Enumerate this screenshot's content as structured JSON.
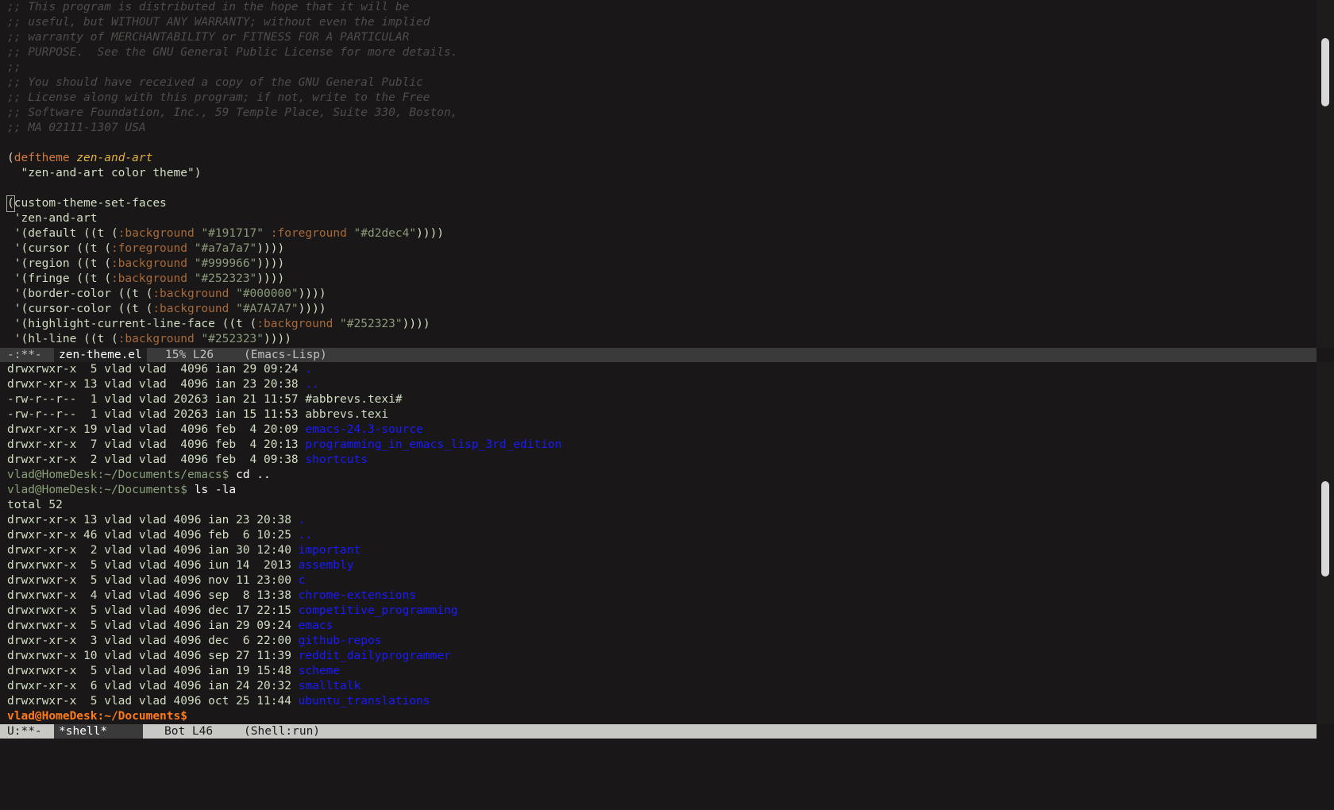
{
  "editor": {
    "top_lines": [
      [
        {
          "t": ";; This program is distributed in the hope that it will be",
          "c": "comment"
        }
      ],
      [
        {
          "t": ";; useful, but WITHOUT ANY WARRANTY; without even the implied",
          "c": "comment"
        }
      ],
      [
        {
          "t": ";; warranty of MERCHANTABILITY or FITNESS FOR A PARTICULAR",
          "c": "comment"
        }
      ],
      [
        {
          "t": ";; PURPOSE.  See the GNU General Public License for more details.",
          "c": "comment"
        }
      ],
      [
        {
          "t": ";;",
          "c": "comment"
        }
      ],
      [
        {
          "t": ";; You should have received a copy of the GNU General Public",
          "c": "comment"
        }
      ],
      [
        {
          "t": ";; License along with this program; if not, write to the Free",
          "c": "comment"
        }
      ],
      [
        {
          "t": ";; Software Foundation, Inc., 59 Temple Place, Suite 330, Boston,",
          "c": "comment"
        }
      ],
      [
        {
          "t": ";; MA 02111-1307 USA",
          "c": "comment"
        }
      ],
      [
        {
          "t": "",
          "c": "plain"
        }
      ],
      [
        {
          "t": "(",
          "c": "plain"
        },
        {
          "t": "deftheme",
          "c": "kw"
        },
        {
          "t": " ",
          "c": "plain"
        },
        {
          "t": "zen-and-art",
          "c": "fn"
        }
      ],
      [
        {
          "t": "  \"zen-and-art color theme\")",
          "c": "str"
        }
      ],
      [
        {
          "t": "",
          "c": "plain"
        }
      ],
      [
        {
          "t": "(",
          "c": "cursor"
        },
        {
          "t": "custom-theme-set-faces",
          "c": "plain"
        }
      ],
      [
        {
          "t": " 'zen-and-art",
          "c": "plain"
        }
      ],
      [
        {
          "t": " '(default ((t (",
          "c": "plain"
        },
        {
          "t": ":background",
          "c": "kwd"
        },
        {
          "t": " ",
          "c": "plain"
        },
        {
          "t": "\"#191717\"",
          "c": "strg"
        },
        {
          "t": " ",
          "c": "plain"
        },
        {
          "t": ":foreground",
          "c": "kwd"
        },
        {
          "t": " ",
          "c": "plain"
        },
        {
          "t": "\"#d2dec4\"",
          "c": "strg"
        },
        {
          "t": "))))",
          "c": "plain"
        }
      ],
      [
        {
          "t": " '(cursor ((t (",
          "c": "plain"
        },
        {
          "t": ":foreground",
          "c": "kwd"
        },
        {
          "t": " ",
          "c": "plain"
        },
        {
          "t": "\"#a7a7a7\"",
          "c": "strg"
        },
        {
          "t": "))))",
          "c": "plain"
        }
      ],
      [
        {
          "t": " '(region ((t (",
          "c": "plain"
        },
        {
          "t": ":background",
          "c": "kwd"
        },
        {
          "t": " ",
          "c": "plain"
        },
        {
          "t": "\"#999966\"",
          "c": "strg"
        },
        {
          "t": "))))",
          "c": "plain"
        }
      ],
      [
        {
          "t": " '(fringe ((t (",
          "c": "plain"
        },
        {
          "t": ":background",
          "c": "kwd"
        },
        {
          "t": " ",
          "c": "plain"
        },
        {
          "t": "\"#252323\"",
          "c": "strg"
        },
        {
          "t": "))))",
          "c": "plain"
        }
      ],
      [
        {
          "t": " '(border-color ((t (",
          "c": "plain"
        },
        {
          "t": ":background",
          "c": "kwd"
        },
        {
          "t": " ",
          "c": "plain"
        },
        {
          "t": "\"#000000\"",
          "c": "strg"
        },
        {
          "t": "))))",
          "c": "plain"
        }
      ],
      [
        {
          "t": " '(cursor-color ((t (",
          "c": "plain"
        },
        {
          "t": ":background",
          "c": "kwd"
        },
        {
          "t": " ",
          "c": "plain"
        },
        {
          "t": "\"#A7A7A7\"",
          "c": "strg"
        },
        {
          "t": "))))",
          "c": "plain"
        }
      ],
      [
        {
          "t": " '(highlight-current-line-face ((t (",
          "c": "plain"
        },
        {
          "t": ":background",
          "c": "kwd"
        },
        {
          "t": " ",
          "c": "plain"
        },
        {
          "t": "\"#252323\"",
          "c": "strg"
        },
        {
          "t": "))))",
          "c": "plain"
        }
      ],
      [
        {
          "t": " '(hl-line ((t (",
          "c": "plain"
        },
        {
          "t": ":background",
          "c": "kwd"
        },
        {
          "t": " ",
          "c": "plain"
        },
        {
          "t": "\"#252323\"",
          "c": "strg"
        },
        {
          "t": "))))",
          "c": "plain"
        }
      ]
    ],
    "top_modeline": {
      "status": "-:**-",
      "buffer": "zen-theme.el",
      "position": "15% L26",
      "mode": "(Emacs-Lisp)"
    }
  },
  "shell": {
    "lines": [
      [
        {
          "t": "drwxrwxr-x  5 vlad vlad  4096 ian 29 09:24 ",
          "c": "plain"
        },
        {
          "t": ".",
          "c": "dir"
        }
      ],
      [
        {
          "t": "drwxr-xr-x 13 vlad vlad  4096 ian 23 20:38 ",
          "c": "plain"
        },
        {
          "t": "..",
          "c": "dir"
        }
      ],
      [
        {
          "t": "-rw-r--r--  1 vlad vlad 20263 ian 21 11:57 #abbrevs.texi#",
          "c": "plain"
        }
      ],
      [
        {
          "t": "-rw-r--r--  1 vlad vlad 20263 ian 15 11:53 abbrevs.texi",
          "c": "plain"
        }
      ],
      [
        {
          "t": "drwxr-xr-x 19 vlad vlad  4096 feb  4 20:09 ",
          "c": "plain"
        },
        {
          "t": "emacs-24.3-source",
          "c": "dir"
        }
      ],
      [
        {
          "t": "drwxr-xr-x  7 vlad vlad  4096 feb  4 20:13 ",
          "c": "plain"
        },
        {
          "t": "programming_in_emacs_lisp_3rd_edition",
          "c": "dir"
        }
      ],
      [
        {
          "t": "drwxr-xr-x  2 vlad vlad  4096 feb  4 09:38 ",
          "c": "plain"
        },
        {
          "t": "shortcuts",
          "c": "dir"
        }
      ],
      [
        {
          "t": "vlad@HomeDesk:~/Documents/emacs$ ",
          "c": "prompt"
        },
        {
          "t": "cd ..",
          "c": "cmd"
        }
      ],
      [
        {
          "t": "vlad@HomeDesk:~/Documents$ ",
          "c": "prompt"
        },
        {
          "t": "ls -la",
          "c": "cmd"
        }
      ],
      [
        {
          "t": "total 52",
          "c": "plain"
        }
      ],
      [
        {
          "t": "drwxr-xr-x 13 vlad vlad 4096 ian 23 20:38 ",
          "c": "plain"
        },
        {
          "t": ".",
          "c": "dir"
        }
      ],
      [
        {
          "t": "drwxr-xr-x 46 vlad vlad 4096 feb  6 10:25 ",
          "c": "plain"
        },
        {
          "t": "..",
          "c": "dir"
        }
      ],
      [
        {
          "t": "drwxr-xr-x  2 vlad vlad 4096 ian 30 12:40 ",
          "c": "plain"
        },
        {
          "t": "important",
          "c": "dir"
        }
      ],
      [
        {
          "t": "drwxrwxr-x  5 vlad vlad 4096 iun 14  2013 ",
          "c": "plain"
        },
        {
          "t": "assembly",
          "c": "dir"
        }
      ],
      [
        {
          "t": "drwxrwxr-x  5 vlad vlad 4096 nov 11 23:00 ",
          "c": "plain"
        },
        {
          "t": "c",
          "c": "dir"
        }
      ],
      [
        {
          "t": "drwxrwxr-x  4 vlad vlad 4096 sep  8 13:38 ",
          "c": "plain"
        },
        {
          "t": "chrome-extensions",
          "c": "dir"
        }
      ],
      [
        {
          "t": "drwxrwxr-x  5 vlad vlad 4096 dec 17 22:15 ",
          "c": "plain"
        },
        {
          "t": "competitive_programming",
          "c": "dir"
        }
      ],
      [
        {
          "t": "drwxrwxr-x  5 vlad vlad 4096 ian 29 09:24 ",
          "c": "plain"
        },
        {
          "t": "emacs",
          "c": "dir"
        }
      ],
      [
        {
          "t": "drwxr-xr-x  3 vlad vlad 4096 dec  6 22:00 ",
          "c": "plain"
        },
        {
          "t": "github-repos",
          "c": "dir"
        }
      ],
      [
        {
          "t": "drwxrwxr-x 10 vlad vlad 4096 sep 27 11:39 ",
          "c": "plain"
        },
        {
          "t": "reddit_dailyprogrammer",
          "c": "dir"
        }
      ],
      [
        {
          "t": "drwxrwxr-x  5 vlad vlad 4096 ian 19 15:48 ",
          "c": "plain"
        },
        {
          "t": "scheme",
          "c": "dir"
        }
      ],
      [
        {
          "t": "drwxr-xr-x  6 vlad vlad 4096 ian 24 20:32 ",
          "c": "plain"
        },
        {
          "t": "smalltalk",
          "c": "dir"
        }
      ],
      [
        {
          "t": "drwxrwxr-x  5 vlad vlad 4096 oct 25 11:44 ",
          "c": "plain"
        },
        {
          "t": "ubuntu_translations",
          "c": "dir"
        }
      ],
      [
        {
          "t": "vlad@HomeDesk:~/Documents$",
          "c": "prompt-active"
        }
      ]
    ],
    "modeline": {
      "status": "U:**-",
      "buffer": "*shell*",
      "position": "Bot L46",
      "mode": "(Shell:run)"
    }
  },
  "colors": {
    "background": "#191717",
    "foreground": "#d2dec4",
    "comment": "#4f4d4b",
    "keyword": "#d47a3e",
    "directory": "#1a1aff",
    "prompt": "#8aa07a",
    "active_prompt": "#ff7a1a"
  }
}
